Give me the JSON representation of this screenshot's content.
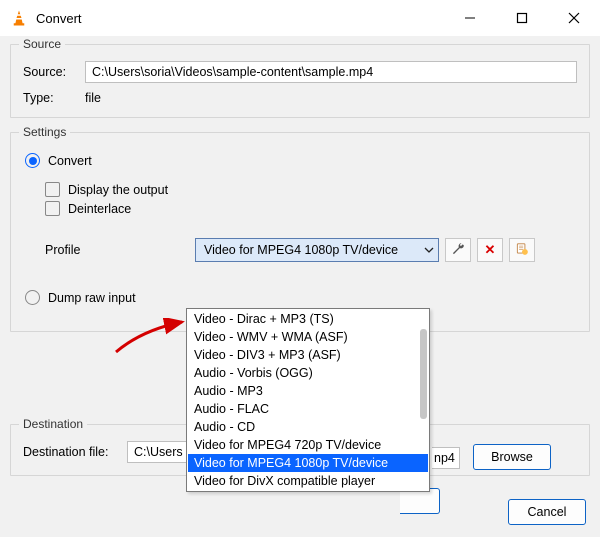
{
  "window": {
    "title": "Convert"
  },
  "source": {
    "legend": "Source",
    "source_label": "Source:",
    "source_value": "C:\\Users\\soria\\Videos\\sample-content\\sample.mp4",
    "type_label": "Type:",
    "type_value": "file"
  },
  "settings": {
    "legend": "Settings",
    "convert_label": "Convert",
    "display_output_label": "Display the output",
    "deinterlace_label": "Deinterlace",
    "profile_label": "Profile",
    "profile_selected": "Video for MPEG4 1080p TV/device",
    "profile_options": [
      "Video - Dirac + MP3 (TS)",
      "Video - WMV + WMA (ASF)",
      "Video - DIV3 + MP3 (ASF)",
      "Audio - Vorbis (OGG)",
      "Audio - MP3",
      "Audio - FLAC",
      "Audio - CD",
      "Video for MPEG4 720p TV/device",
      "Video for MPEG4 1080p TV/device",
      "Video for DivX compatible player"
    ],
    "dump_raw_label": "Dump raw input"
  },
  "destination": {
    "legend": "Destination",
    "file_label": "Destination file:",
    "file_value_visible_prefix": "C:\\Users",
    "file_value_visible_suffix": "np4",
    "browse_label": "Browse"
  },
  "buttons": {
    "start_visible": "",
    "cancel": "Cancel"
  },
  "icons": {
    "wrench": "wrench",
    "delete": "×",
    "new": "new"
  }
}
